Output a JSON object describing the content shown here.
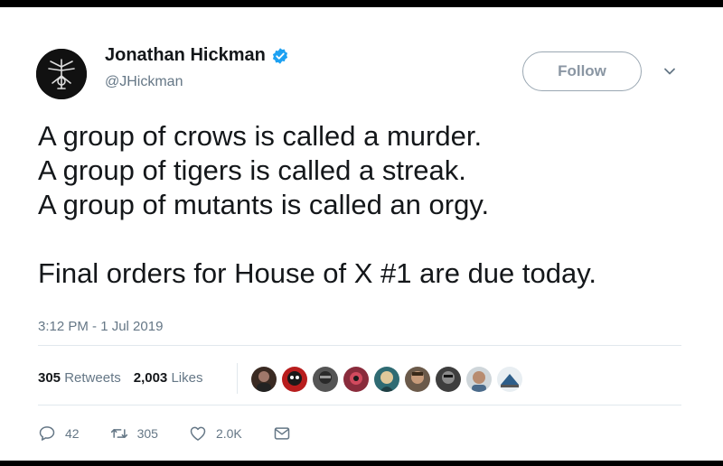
{
  "tweet": {
    "display_name": "Jonathan Hickman",
    "handle": "@JHickman",
    "follow_label": "Follow",
    "lines": [
      "A group of crows is called a murder.",
      "A group of tigers is called a streak.",
      "A group of mutants is called an orgy.",
      "Final orders for House of X #1 are due today."
    ],
    "timestamp": "3:12 PM - 1 Jul 2019",
    "stats": {
      "retweets_count": "305",
      "retweets_label": "Retweets",
      "likes_count": "2,003",
      "likes_label": "Likes"
    },
    "actions": {
      "reply_count": "42",
      "retweet_count": "305",
      "like_count": "2.0K"
    }
  },
  "colors": {
    "verified": "#1da1f2",
    "secondary_text": "#657786",
    "divider": "#e1e8ed"
  }
}
